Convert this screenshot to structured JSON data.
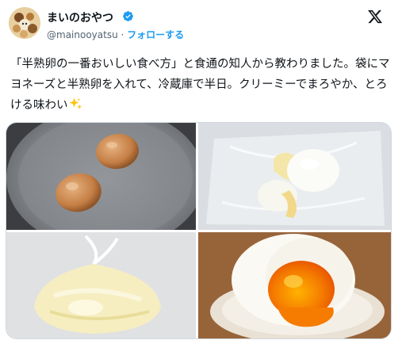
{
  "user": {
    "display_name": "まいのおやつ",
    "handle": "@mainooyatsu",
    "separator": "·",
    "follow_label": "フォローする"
  },
  "tweet": {
    "text": "「半熟卵の一番おいしい食べ方」と食通の知人から教わりました。袋にマヨネーズと半熟卵を入れて、冷蔵庫で半日。クリーミーでまろやか、とろける味わい"
  },
  "icons": {
    "verified": "verified-badge-icon",
    "logo": "x-logo-icon",
    "sparkles": "sparkles-emoji-icon"
  },
  "colors": {
    "accent": "#1d9bf0",
    "text": "#0f1419",
    "secondary": "#536471"
  },
  "media": {
    "photos": [
      {
        "name": "photo-boiled-eggs-in-pot"
      },
      {
        "name": "photo-eggs-in-bag-with-mayo"
      },
      {
        "name": "photo-bag-tied-mayo"
      },
      {
        "name": "photo-soft-boiled-egg-cut"
      }
    ]
  }
}
